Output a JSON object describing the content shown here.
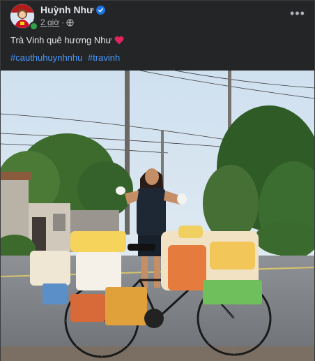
{
  "post": {
    "author_name": "Huỳnh Như",
    "verified": true,
    "time": "2 giờ",
    "audience": "globe-icon",
    "caption": "Trà Vinh quê hương Như",
    "caption_emoji": "red-heart",
    "hashtags": [
      "#cauthuhuynhnhu",
      "#travinh"
    ]
  },
  "colors": {
    "background": "#242526",
    "text": "#e4e6eb",
    "secondary_text": "#b0b3b8",
    "link": "#4599ff",
    "verified_badge": "#1b74e4",
    "online": "#31a24c"
  }
}
